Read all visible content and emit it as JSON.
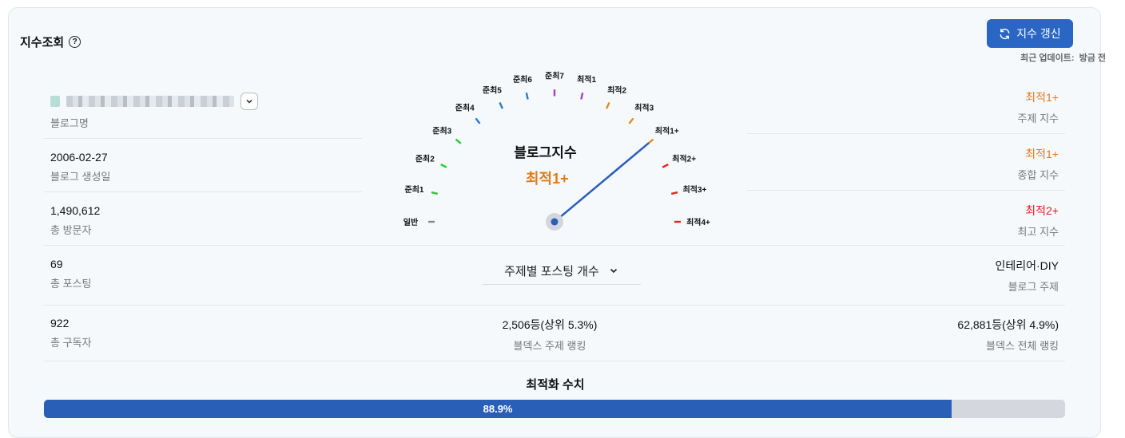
{
  "header": {
    "title": "지수조회",
    "refresh_label": "지수 갱신",
    "update_label": "최근 업데이트:",
    "update_value": "방금 전"
  },
  "left_stats": [
    {
      "value": "",
      "label": "블로그명"
    },
    {
      "value": "2006-02-27",
      "label": "블로그 생성일"
    },
    {
      "value": "1,490,612",
      "label": "총 방문자"
    },
    {
      "value": "69",
      "label": "총 포스팅"
    },
    {
      "value": "922",
      "label": "총 구독자"
    }
  ],
  "right_stats": [
    {
      "value": "최적1+",
      "label": "주제 지수",
      "color": "#e07b1c"
    },
    {
      "value": "최적1+",
      "label": "종합 지수",
      "color": "#e07b1c"
    },
    {
      "value": "최적2+",
      "label": "최고 지수",
      "color": "#e02020"
    },
    {
      "value": "인테리어·DIY",
      "label": "블로그 주제",
      "color": "#111111"
    },
    {
      "value": "62,881등(상위 4.9%)",
      "label": "블덱스 전체 랭킹",
      "color": "#111111"
    }
  ],
  "gauge": {
    "title": "블로그지수",
    "value": "최적1+",
    "value_color": "#e07b1c",
    "current_level_index": 11,
    "levels": [
      {
        "label": "일반",
        "color": "#888888"
      },
      {
        "label": "준최1",
        "color": "#22cc33"
      },
      {
        "label": "준최2",
        "color": "#22cc33"
      },
      {
        "label": "준최3",
        "color": "#22cc33"
      },
      {
        "label": "준최4",
        "color": "#2a7ad0"
      },
      {
        "label": "준최5",
        "color": "#2a7ad0"
      },
      {
        "label": "준최6",
        "color": "#2a7ad0"
      },
      {
        "label": "준최7",
        "color": "#a040d0"
      },
      {
        "label": "최적1",
        "color": "#a040d0"
      },
      {
        "label": "최적2",
        "color": "#e88a1c"
      },
      {
        "label": "최적3",
        "color": "#e88a1c"
      },
      {
        "label": "최적1+",
        "color": "#e88a1c"
      },
      {
        "label": "최적2+",
        "color": "#e82020"
      },
      {
        "label": "최적3+",
        "color": "#e82020"
      },
      {
        "label": "최적4+",
        "color": "#e82020"
      }
    ]
  },
  "topic_select": {
    "label": "주제별 포스팅 개수"
  },
  "center_stat": {
    "value": "2,506등(상위 5.3%)",
    "label": "블덱스 주제 랭킹"
  },
  "optimization": {
    "title": "최적화 수치",
    "percent": 88.9,
    "label": "88.9%"
  }
}
